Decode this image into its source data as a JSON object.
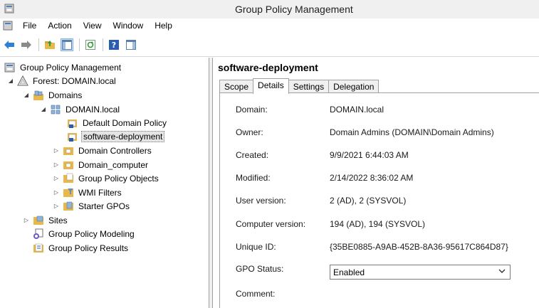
{
  "window": {
    "title": "Group Policy Management"
  },
  "menu": [
    "File",
    "Action",
    "View",
    "Window",
    "Help"
  ],
  "tree": {
    "root": "Group Policy Management",
    "forest": "Forest: DOMAIN.local",
    "domains": "Domains",
    "domain": "DOMAIN.local",
    "gpo_default": "Default Domain Policy",
    "gpo_selected": "software-deployment",
    "domain_controllers": "Domain Controllers",
    "domain_computer": "Domain_computer",
    "gpo_objects": "Group Policy Objects",
    "wmi_filters": "WMI Filters",
    "starter_gpos": "Starter GPOs",
    "sites": "Sites",
    "modeling": "Group Policy Modeling",
    "results": "Group Policy Results"
  },
  "details": {
    "header": "software-deployment",
    "tabs": [
      "Scope",
      "Details",
      "Settings",
      "Delegation"
    ],
    "active_tab": "Details",
    "fields": {
      "domain_label": "Domain:",
      "domain_value": "DOMAIN.local",
      "owner_label": "Owner:",
      "owner_value": "Domain Admins (DOMAIN\\Domain Admins)",
      "created_label": "Created:",
      "created_value": "9/9/2021 6:44:03 AM",
      "modified_label": "Modified:",
      "modified_value": "2/14/2022 8:36:02 AM",
      "user_version_label": "User version:",
      "user_version_value": "2 (AD), 2 (SYSVOL)",
      "computer_version_label": "Computer version:",
      "computer_version_value": "194 (AD), 194 (SYSVOL)",
      "unique_id_label": "Unique ID:",
      "unique_id_value": "{35BE0885-A9AB-452B-8A36-95617C864D87}",
      "gpo_status_label": "GPO Status:",
      "gpo_status_value": "Enabled",
      "comment_label": "Comment:"
    }
  },
  "colors": {
    "accent": "#1e6fc4",
    "folder": "#e8b84a",
    "title_bg": "#f0f0f0"
  }
}
